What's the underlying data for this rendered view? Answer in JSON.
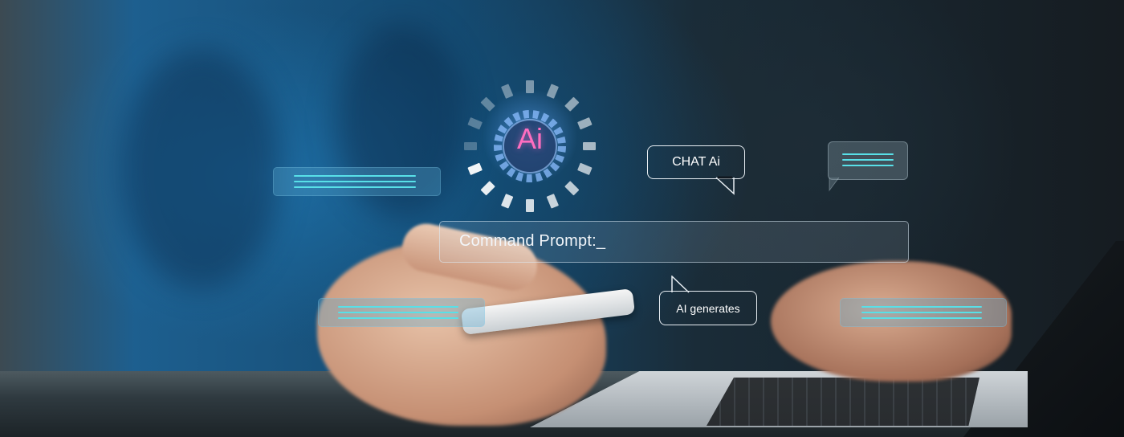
{
  "image": {
    "subject": "person-using-smartphone-and-laptop"
  },
  "overlay": {
    "ai_badge": "Ai",
    "chat_bubble": "CHAT Ai",
    "prompt_label": "Command Prompt",
    "prompt_cursor": ":_",
    "generate_bubble": "AI generates"
  },
  "colors": {
    "ai_badge_text": "#ff6ec0",
    "accent_lines": "#58e0e8",
    "prompt_text": "#f2f6fa"
  },
  "icons": [
    "gear-icon",
    "loading-ring-icon",
    "chat-bubble-icon",
    "message-icon"
  ]
}
